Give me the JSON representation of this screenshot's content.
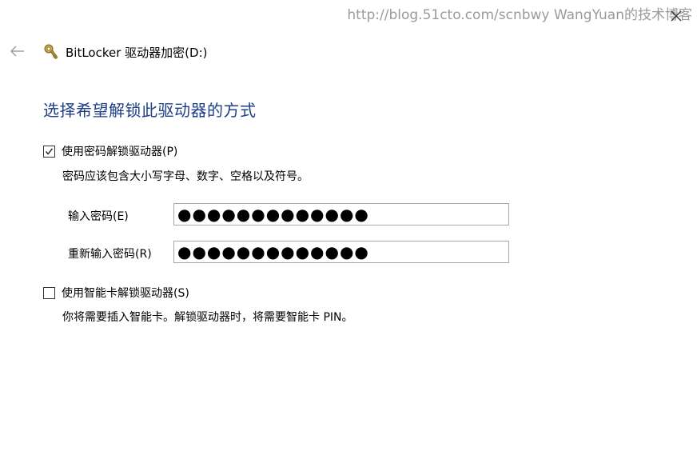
{
  "watermark": "http://blog.51cto.com/scnbwy WangYuan的技术博客",
  "window": {
    "title": "BitLocker 驱动器加密(D:)"
  },
  "icons": {
    "back": "back-arrow-icon",
    "close": "close-icon",
    "app": "bitlocker-key-icon",
    "check": "checkmark-icon"
  },
  "main": {
    "heading": "选择希望解锁此驱动器的方式",
    "password_option": {
      "label": "使用密码解锁驱动器(P)",
      "checked": true,
      "hint": "密码应该包含大小写字母、数字、空格以及符号。",
      "enter_label": "输入密码(E)",
      "enter_value": "●●●●●●●●●●●●●",
      "reenter_label": "重新输入密码(R)",
      "reenter_value": "●●●●●●●●●●●●●"
    },
    "smartcard_option": {
      "label": "使用智能卡解锁驱动器(S)",
      "checked": false,
      "hint": "你将需要插入智能卡。解锁驱动器时，将需要智能卡 PIN。"
    }
  },
  "colors": {
    "heading": "#1f3f86",
    "watermark": "#9a9a9a",
    "input_border": "#a8a8a8"
  }
}
